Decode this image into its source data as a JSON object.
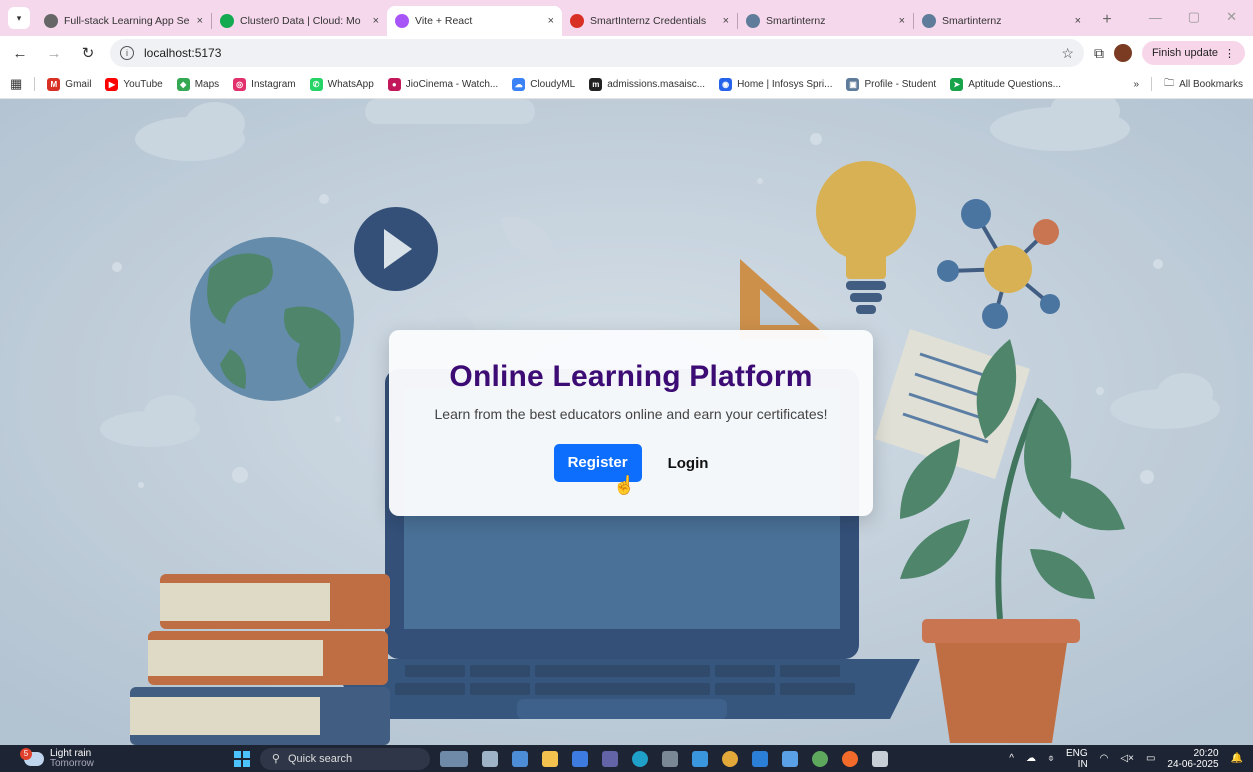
{
  "browser": {
    "tab_menu_icon": "chevron-down-icon",
    "tabs": [
      {
        "title": "Full-stack Learning App Se",
        "fav": "globe",
        "fav_color": "#666666",
        "active": false
      },
      {
        "title": "Cluster0 Data | Cloud: Mo",
        "fav": "mongodb",
        "fav_color": "#13aa52",
        "active": false
      },
      {
        "title": "Vite + React",
        "fav": "vite",
        "fav_color": "#a855f7",
        "active": true
      },
      {
        "title": "SmartInternz Credentials",
        "fav": "gmail",
        "fav_color": "#d93025",
        "active": false
      },
      {
        "title": "Smartinternz",
        "fav": "smartinternz",
        "fav_color": "#5f7c9a",
        "active": false
      },
      {
        "title": "Smartinternz",
        "fav": "smartinternz",
        "fav_color": "#5f7c9a",
        "active": false
      }
    ],
    "tab_close": "×",
    "new_tab": "+",
    "url": "localhost:5173",
    "update_label": "Finish update",
    "bookmarks": [
      {
        "label": "Gmail",
        "icon": "gmail-icon",
        "color": "#d93025",
        "glyph": "M"
      },
      {
        "label": "YouTube",
        "icon": "youtube-icon",
        "color": "#ff0000",
        "glyph": "▶"
      },
      {
        "label": "Maps",
        "icon": "maps-icon",
        "color": "#34a853",
        "glyph": "◆"
      },
      {
        "label": "Instagram",
        "icon": "instagram-icon",
        "color": "#e1306c",
        "glyph": "◎"
      },
      {
        "label": "WhatsApp",
        "icon": "whatsapp-icon",
        "color": "#25d366",
        "glyph": "✆"
      },
      {
        "label": "JioCinema - Watch...",
        "icon": "jiocinema-icon",
        "color": "#c2185b",
        "glyph": "●"
      },
      {
        "label": "CloudyML",
        "icon": "cloudyml-icon",
        "color": "#3b82f6",
        "glyph": "☁"
      },
      {
        "label": "admissions.masaisc...",
        "icon": "masai-icon",
        "color": "#222222",
        "glyph": "m"
      },
      {
        "label": "Home | Infosys Spri...",
        "icon": "infosys-icon",
        "color": "#2563eb",
        "glyph": "◉"
      },
      {
        "label": "Profile - Student",
        "icon": "smartinternz-icon",
        "color": "#5f7c9a",
        "glyph": "▣"
      },
      {
        "label": "Aptitude Questions...",
        "icon": "aptitude-icon",
        "color": "#16a34a",
        "glyph": "➤"
      }
    ],
    "bookmarks_overflow": "»",
    "all_bookmarks": "All Bookmarks"
  },
  "page": {
    "title": "Online Learning Platform",
    "subtitle": "Learn from the best educators online and earn your certificates!",
    "register_label": "Register",
    "login_label": "Login",
    "accent": "#0d6efd",
    "title_color": "#3c0b73"
  },
  "taskbar": {
    "weather_badge": "5",
    "weather_line1": "Light rain",
    "weather_line2": "Tomorrow",
    "search_placeholder": "Quick search",
    "lang_line1": "ENG",
    "lang_line2": "IN",
    "time": "20:20",
    "date": "24-06-2025"
  }
}
